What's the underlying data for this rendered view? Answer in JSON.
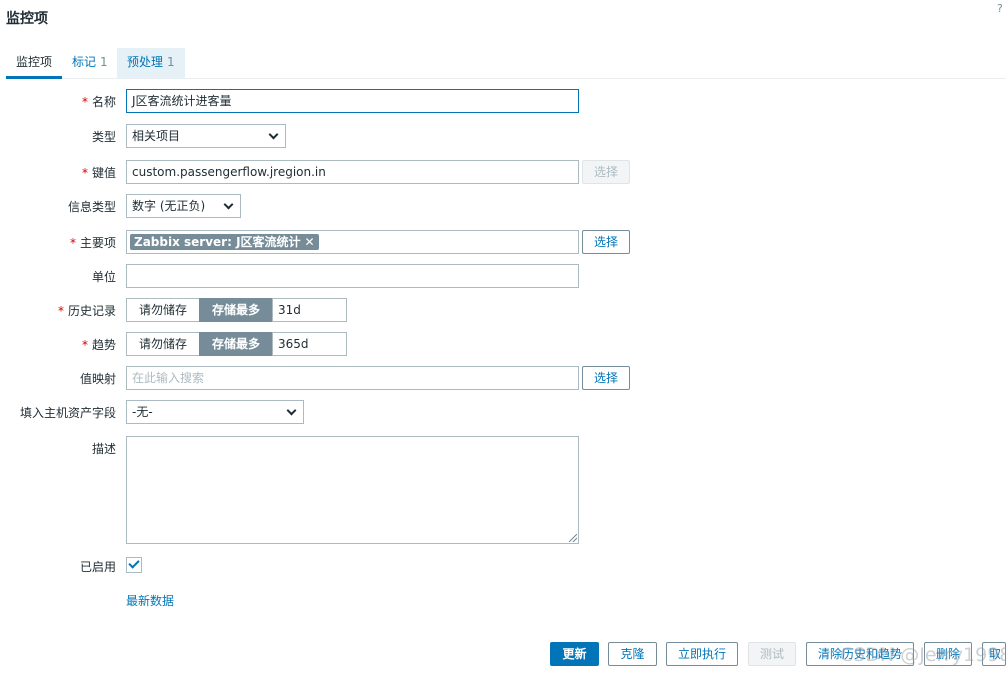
{
  "window": {
    "title": "监控项",
    "help": "?"
  },
  "tabs": [
    {
      "label": "监控项",
      "count": ""
    },
    {
      "label": "标记",
      "count": "1"
    },
    {
      "label": "预处理",
      "count": "1"
    }
  ],
  "form": {
    "name": {
      "label": "名称",
      "value": "J区客流统计进客量"
    },
    "type": {
      "label": "类型",
      "value": "相关项目"
    },
    "key": {
      "label": "键值",
      "value": "custom.passengerflow.jregion.in",
      "button": "选择"
    },
    "info_type": {
      "label": "信息类型",
      "value": "数字 (无正负)"
    },
    "master_item": {
      "label": "主要项",
      "chip": "Zabbix server: J区客流统计",
      "chip_remove": "✕",
      "button": "选择"
    },
    "units": {
      "label": "单位",
      "value": ""
    },
    "history": {
      "label": "历史记录",
      "opt_off": "请勿储存",
      "opt_on": "存储最多",
      "value": "31d"
    },
    "trends": {
      "label": "趋势",
      "opt_off": "请勿储存",
      "opt_on": "存储最多",
      "value": "365d"
    },
    "valuemap": {
      "label": "值映射",
      "placeholder": "在此输入搜索",
      "button": "选择"
    },
    "inventory": {
      "label": "填入主机资产字段",
      "value": "-无-"
    },
    "description": {
      "label": "描述",
      "value": ""
    },
    "enabled": {
      "label": "已启用",
      "checked": true
    },
    "latest_data_link": "最新数据"
  },
  "actions": {
    "update": "更新",
    "clone": "克隆",
    "execute_now": "立即执行",
    "test": "测试",
    "clear_history": "清除历史和趋势",
    "delete": "删除",
    "cancel": "取"
  },
  "watermark": "CSDN @Jerry1998",
  "colors": {
    "accent": "#0275b8",
    "required": "#d40000",
    "segment_on": "#768d99"
  }
}
